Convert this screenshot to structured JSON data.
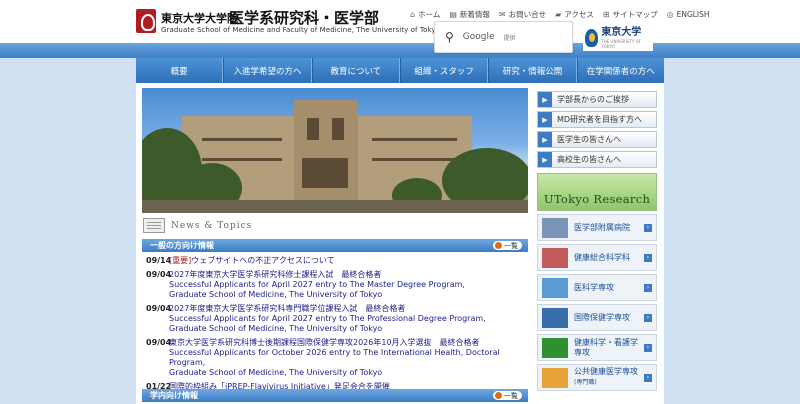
{
  "header": {
    "title_jp_university": "東京大学大学院",
    "title_jp_school": "医学系研究科・医学部",
    "title_en": "Graduate School of Medicine and Faculty of Medicine, The University of Tokyo",
    "top_links": [
      {
        "icon": "home-icon",
        "label": "ホーム"
      },
      {
        "icon": "news-icon",
        "label": "新着情報"
      },
      {
        "icon": "mail-icon",
        "label": "お問い合せ"
      },
      {
        "icon": "car-icon",
        "label": "アクセス"
      },
      {
        "icon": "sitemap-icon",
        "label": "サイトマップ"
      },
      {
        "icon": "globe-icon",
        "label": "ENGLISH"
      }
    ],
    "search": {
      "brand": "Google",
      "sub": "提供"
    },
    "utokyo_logo": {
      "name": "東京大学",
      "sub": "THE UNIVERSITY OF TOKYO"
    }
  },
  "nav": {
    "items": [
      "概要",
      "入進学希望の方へ",
      "教育について",
      "組織・スタッフ",
      "研究・情報公開",
      "在学関係者の方へ"
    ]
  },
  "news": {
    "heading": "News & Topics",
    "categories": [
      {
        "label": "一般の方向け情報",
        "more": "一覧"
      },
      {
        "label": "学内向け情報",
        "more": "一覧"
      }
    ],
    "items": [
      {
        "date": "09/14",
        "tag": "[重要]",
        "text": "ウェブサイトへの不正アクセスについて"
      },
      {
        "date": "09/04",
        "tag": "",
        "text": "2027年度東京大学医学系研究科修士課程入試　最終合格者"
      },
      {
        "date": "",
        "tag": "",
        "text": "Successful Applicants for April 2027 entry to The Master Degree Program,"
      },
      {
        "date": "",
        "tag": "",
        "text": "Graduate School of Medicine, The University of Tokyo"
      },
      {
        "date": "09/04",
        "tag": "",
        "text": "2027年度東京大学医学系研究科専門職学位課程入試　最終合格者"
      },
      {
        "date": "",
        "tag": "",
        "text": "Successful Applicants for April 2027 entry to The Professional Degree Program,"
      },
      {
        "date": "",
        "tag": "",
        "text": "Graduate School of Medicine, The University of Tokyo"
      },
      {
        "date": "09/04",
        "tag": "",
        "text": "東京大学医学系研究科博士後期課程国際保健学専攻2026年10月入学選抜　最終合格者"
      },
      {
        "date": "",
        "tag": "",
        "text": "Successful Applicants for October 2026 entry to The International Health, Doctoral Program,"
      },
      {
        "date": "",
        "tag": "",
        "text": "Graduate School of Medicine, The University of Tokyo"
      },
      {
        "date": "01/22",
        "tag": "",
        "text": "国際的枠組み「iPREP-Flavivirus Initiative」発足会合を開催"
      }
    ]
  },
  "sidebar": {
    "buttons": [
      "学部長からのご挨拶",
      "MD研究者を目指す方へ",
      "医学生の皆さんへ",
      "高校生の皆さんへ"
    ],
    "research_banner": "UTokyo Research",
    "links": [
      {
        "label": "医学部附属病院",
        "thumb_color": "#7a93b8"
      },
      {
        "label": "健康総合科学科",
        "thumb_color": "#c25c5c"
      },
      {
        "label": "医科学専攻",
        "thumb_color": "#5a9bd5"
      },
      {
        "label": "国際保健学専攻",
        "thumb_color": "#3a6eaa"
      },
      {
        "label": "健康科学・看護学専攻",
        "thumb_color": "#2f8f2f"
      },
      {
        "label": "公共健康医学専攻",
        "sub": "(専門職)",
        "thumb_color": "#e8a23a"
      }
    ]
  },
  "colors": {
    "accent": "#3b7cc4",
    "link": "#1b1f8a",
    "important": "#b01e23"
  }
}
